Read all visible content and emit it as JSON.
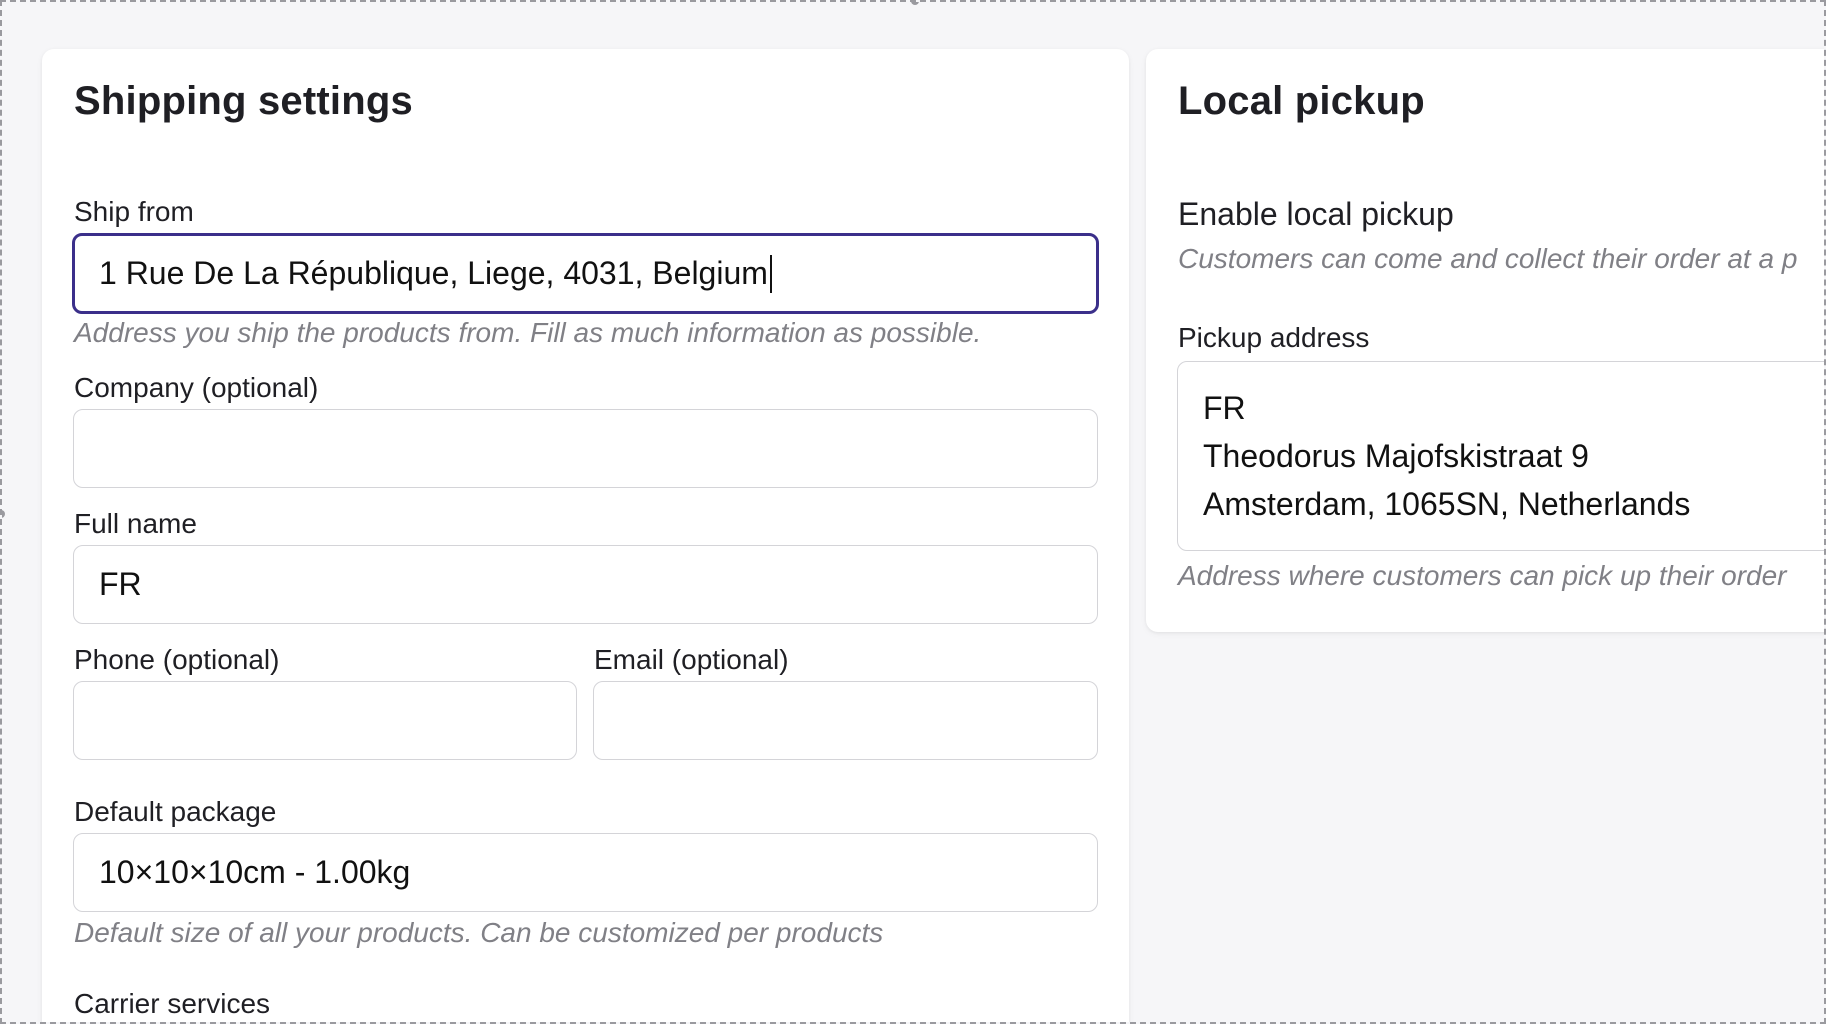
{
  "shipping": {
    "title": "Shipping settings",
    "ship_from": {
      "label": "Ship from",
      "value": "1 Rue De La République, Liege, 4031, Belgium",
      "hint": "Address you ship the products from. Fill as much information as possible."
    },
    "company": {
      "label": "Company (optional)",
      "value": ""
    },
    "full_name": {
      "label": "Full name",
      "value": "FR"
    },
    "phone": {
      "label": "Phone (optional)",
      "value": ""
    },
    "email": {
      "label": "Email (optional)",
      "value": ""
    },
    "default_package": {
      "label": "Default package",
      "value": "10×10×10cm - 1.00kg",
      "hint": "Default size of all your products. Can be customized per products"
    },
    "carrier_services": {
      "label": "Carrier services"
    }
  },
  "local_pickup": {
    "title": "Local pickup",
    "enable": {
      "label": "Enable local pickup",
      "hint": "Customers can come and collect their order at a p"
    },
    "pickup_address": {
      "label": "Pickup address",
      "lines": [
        "FR",
        "Theodorus Majofskistraat 9",
        "Amsterdam, 1065SN, Netherlands"
      ],
      "hint": "Address where customers can pick up their order"
    }
  },
  "colors": {
    "focus_border": "#3b2f8a",
    "hint_text": "#808086",
    "page_bg": "#f6f6f8"
  }
}
